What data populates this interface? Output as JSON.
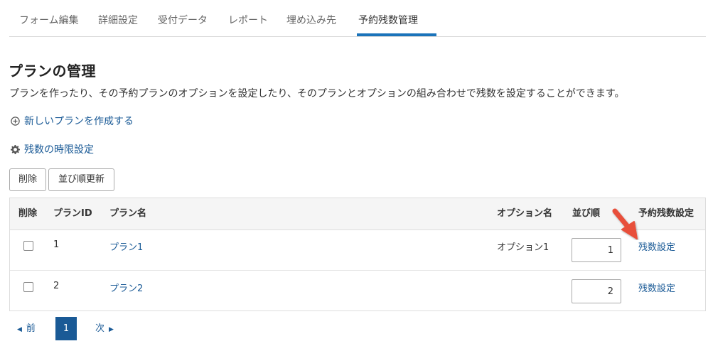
{
  "tabs": [
    {
      "label": "フォーム編集"
    },
    {
      "label": "詳細設定"
    },
    {
      "label": "受付データ"
    },
    {
      "label": "レポート"
    },
    {
      "label": "埋め込み先"
    },
    {
      "label": "予約残数管理",
      "active": true
    }
  ],
  "page": {
    "title": "プランの管理",
    "description": "プランを作ったり、その予約プランのオプションを設定したり、そのプランとオプションの組み合わせで残数を設定することができます。"
  },
  "links": {
    "new_plan": {
      "label": "新しいプランを作成する",
      "icon": "plus-circle-icon"
    },
    "limit_settings": {
      "label": "残数の時限設定",
      "icon": "gear-icon"
    }
  },
  "toolbar": {
    "delete_label": "削除",
    "reorder_label": "並び順更新"
  },
  "table": {
    "headers": {
      "delete": "削除",
      "plan_id": "プランID",
      "plan_name": "プラン名",
      "option_name": "オプション名",
      "order": "並び順",
      "stock": "予約残数設定"
    },
    "rows": [
      {
        "checked": false,
        "plan_id": "1",
        "plan_name": "プラン1",
        "option_name": "オプション1",
        "order": "1",
        "stock_link": "残数設定"
      },
      {
        "checked": false,
        "plan_id": "2",
        "plan_name": "プラン2",
        "option_name": "",
        "order": "2",
        "stock_link": "残数設定"
      }
    ]
  },
  "pagination": {
    "prev_label": "前",
    "current_page": "1",
    "next_label": "次"
  },
  "colors": {
    "accent": "#1a73ba",
    "link": "#1a5a96",
    "annotation_arrow": "#e8503a"
  }
}
